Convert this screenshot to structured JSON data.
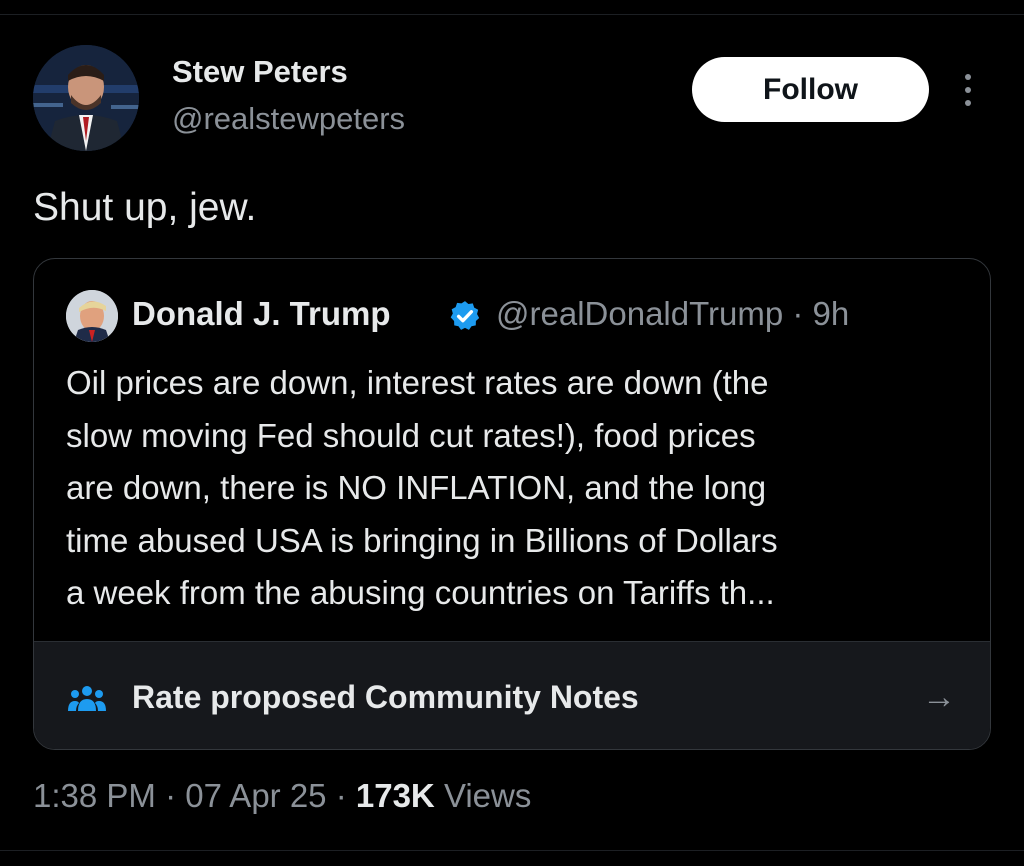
{
  "author": {
    "name": "Stew Peters",
    "handle": "@realstewpeters",
    "follow_label": "Follow"
  },
  "tweet": {
    "text": "Shut up, jew."
  },
  "quoted": {
    "name": "Donald J. Trump",
    "meta": "@realDonaldTrump · 9h",
    "lines": [
      "Oil prices are down, interest rates are down (the",
      "slow moving Fed should cut rates!), food prices",
      "are down, there is NO INFLATION, and the long",
      "time abused USA is bringing in Billions of Dollars",
      "a week from the abusing countries on Tariffs th..."
    ],
    "notes_label": "Rate proposed Community Notes",
    "notes_arrow": "→"
  },
  "footer": {
    "time": "1:38 PM",
    "date": "07 Apr 25",
    "views_count": "173K",
    "views_label": "Views"
  },
  "colors": {
    "background": "#000000",
    "text": "#e7e9ea",
    "muted": "#8b9198",
    "verified": "#1d9bf0",
    "notes_icon": "#1d9bf0"
  },
  "icons": {
    "verified": "verified-badge-icon",
    "notes": "community-notes-icon",
    "more": "more-icon",
    "arrow": "arrow-right-icon"
  }
}
